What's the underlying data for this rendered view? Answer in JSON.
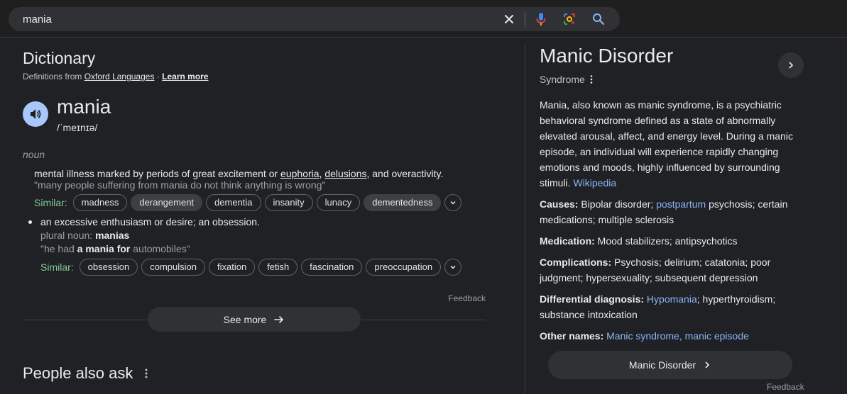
{
  "search": {
    "query": "mania"
  },
  "dictionary": {
    "title": "Dictionary",
    "definitions_from_prefix": "Definitions from",
    "source": "Oxford Languages",
    "separator": "·",
    "learn_more": "Learn more",
    "word": "mania",
    "phonetic": "/ˈmeɪnɪə/",
    "part_of_speech": "noun",
    "sense1": {
      "def_a": "mental illness marked by periods of great excitement or ",
      "link1": "euphoria",
      "comma": ", ",
      "link2": "delusions",
      "def_b": ", and overactivity.",
      "example": "\"many people suffering from mania do not think anything is wrong\"",
      "similar_label": "Similar:",
      "similar": [
        "madness",
        "derangement",
        "dementia",
        "insanity",
        "lunacy",
        "dementedness"
      ]
    },
    "sense2": {
      "def": "an excessive enthusiasm or desire; an obsession.",
      "plural_label": "plural noun: ",
      "plural": "manias",
      "ex_a": "\"he had ",
      "ex_bold": "a mania for",
      "ex_b": " automobiles\"",
      "similar_label": "Similar:",
      "similar": [
        "obsession",
        "compulsion",
        "fixation",
        "fetish",
        "fascination",
        "preoccupation"
      ]
    },
    "feedback": "Feedback",
    "see_more": "See more"
  },
  "people_also_ask": {
    "title": "People also ask"
  },
  "knowledge_panel": {
    "title": "Manic Disorder",
    "subtitle": "Syndrome",
    "description": "Mania, also known as manic syndrome, is a psychiatric behavioral syndrome defined as a state of abnormally elevated arousal, affect, and energy level. During a manic episode, an individual will experience rapidly changing emotions and moods, highly influenced by surrounding stimuli. ",
    "wikipedia": "Wikipedia",
    "causes_label": "Causes:",
    "causes_a": " Bipolar disorder; ",
    "causes_link": "postpartum",
    "causes_b": " psychosis; certain medications; multiple sclerosis",
    "medication_label": "Medication:",
    "medication": " Mood stabilizers; antipsychotics",
    "complications_label": "Complications:",
    "complications": " Psychosis; delirium; catatonia; poor judgment; hypersexuality; subsequent depression",
    "differential_label": "Differential diagnosis:",
    "differential_link": "Hypomania",
    "differential_b": "; hyperthyroidism; substance intoxication",
    "other_names_label": "Other names:",
    "other_names": "Manic syndrome, manic episode",
    "button": "Manic Disorder",
    "feedback": "Feedback"
  },
  "colors": {
    "accent_blue": "#8ab4f8",
    "similar_green": "#81c995",
    "background": "#202124"
  }
}
